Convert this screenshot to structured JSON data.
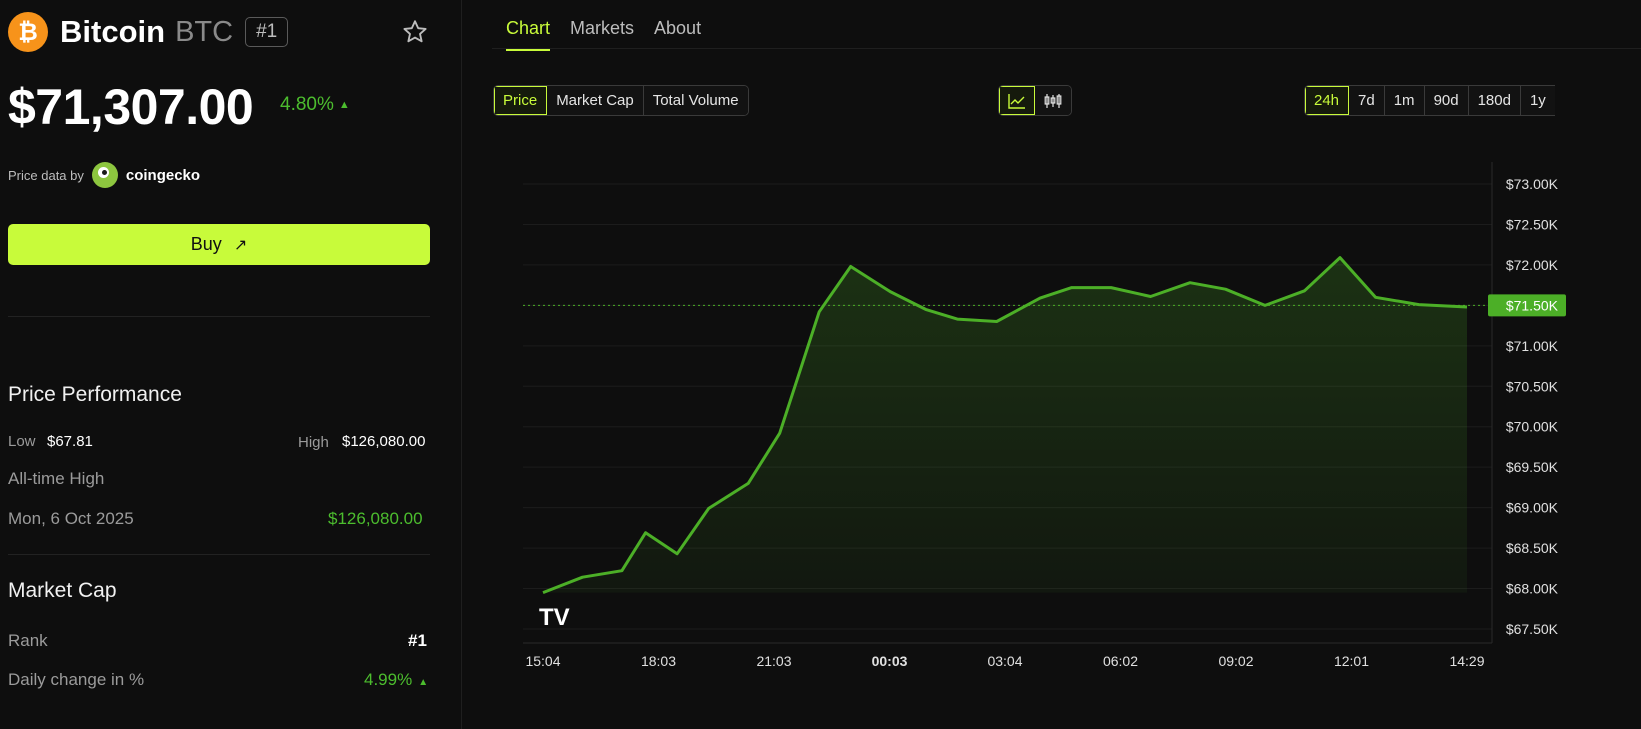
{
  "coin": {
    "name": "Bitcoin",
    "symbol": "BTC",
    "rank_badge": "#1",
    "logo_glyph": "₿",
    "logo_color": "#f7931a",
    "price": "$71,307.00",
    "change": "4.80%",
    "change_arrow": "▲",
    "price_source_label": "Price data by",
    "price_source_name": "coingecko"
  },
  "buy": {
    "label": "Buy",
    "arrow": "↗"
  },
  "performance": {
    "title": "Price Performance",
    "low_label": "Low",
    "low_value": "$67.81",
    "high_label": "High",
    "high_value": "$126,080.00",
    "ath_label": "All-time High",
    "ath_date": "Mon, 6 Oct 2025",
    "ath_value": "$126,080.00"
  },
  "market_cap": {
    "title": "Market Cap",
    "rank_label": "Rank",
    "rank_value": "#1",
    "daily_change_label": "Daily change in %",
    "daily_change_value": "4.99%",
    "daily_change_arrow": "▲"
  },
  "tabs": [
    {
      "label": "Chart",
      "active": true
    },
    {
      "label": "Markets",
      "active": false
    },
    {
      "label": "About",
      "active": false
    }
  ],
  "metric_buttons": [
    {
      "label": "Price",
      "active": true
    },
    {
      "label": "Market Cap",
      "active": false
    },
    {
      "label": "Total Volume",
      "active": false
    }
  ],
  "chart_type_buttons": [
    {
      "icon": "line-chart-icon",
      "active": true
    },
    {
      "icon": "candlestick-icon",
      "active": false
    }
  ],
  "range_buttons": [
    {
      "label": "24h",
      "active": true
    },
    {
      "label": "7d",
      "active": false
    },
    {
      "label": "1m",
      "active": false
    },
    {
      "label": "90d",
      "active": false
    },
    {
      "label": "180d",
      "active": false
    },
    {
      "label": "1y",
      "active": false
    }
  ],
  "colors": {
    "accent": "#c8fb3a",
    "up": "#4cbd2e",
    "line": "#4caf27",
    "background": "#0e0e0e"
  },
  "chart_data": {
    "type": "area",
    "x_tick_labels": [
      "15:04",
      "18:03",
      "21:03",
      "00:03",
      "03:04",
      "06:02",
      "09:02",
      "12:01",
      "14:29"
    ],
    "y_tick_labels": [
      "$73.00K",
      "$72.50K",
      "$72.00K",
      "$71.50K",
      "$71.00K",
      "$70.50K",
      "$70.00K",
      "$69.50K",
      "$69.00K",
      "$68.50K",
      "$68.00K",
      "$67.50K"
    ],
    "ylim": [
      67500,
      73000
    ],
    "x_range_hours": [
      0,
      23.42
    ],
    "current_value": 71500,
    "current_label": "$71.50K",
    "grid": true,
    "series": [
      {
        "x_hours": [
          0,
          1,
          2,
          2.6,
          3.4,
          4.2,
          5.2,
          6.0,
          7.0,
          7.8,
          8.8,
          9.7,
          10.5,
          11.5,
          12.6,
          13.4,
          14.4,
          15.4,
          16.4,
          17.3,
          18.3,
          19.3,
          20.2,
          21.1,
          22.2,
          23.42
        ],
        "values": [
          67950,
          68140,
          68220,
          68690,
          68430,
          68990,
          69300,
          69920,
          71420,
          71980,
          71670,
          71450,
          71330,
          71300,
          71590,
          71720,
          71720,
          71610,
          71780,
          71700,
          71500,
          71680,
          72090,
          71600,
          71510,
          71480
        ]
      }
    ],
    "watermark": "TV"
  }
}
